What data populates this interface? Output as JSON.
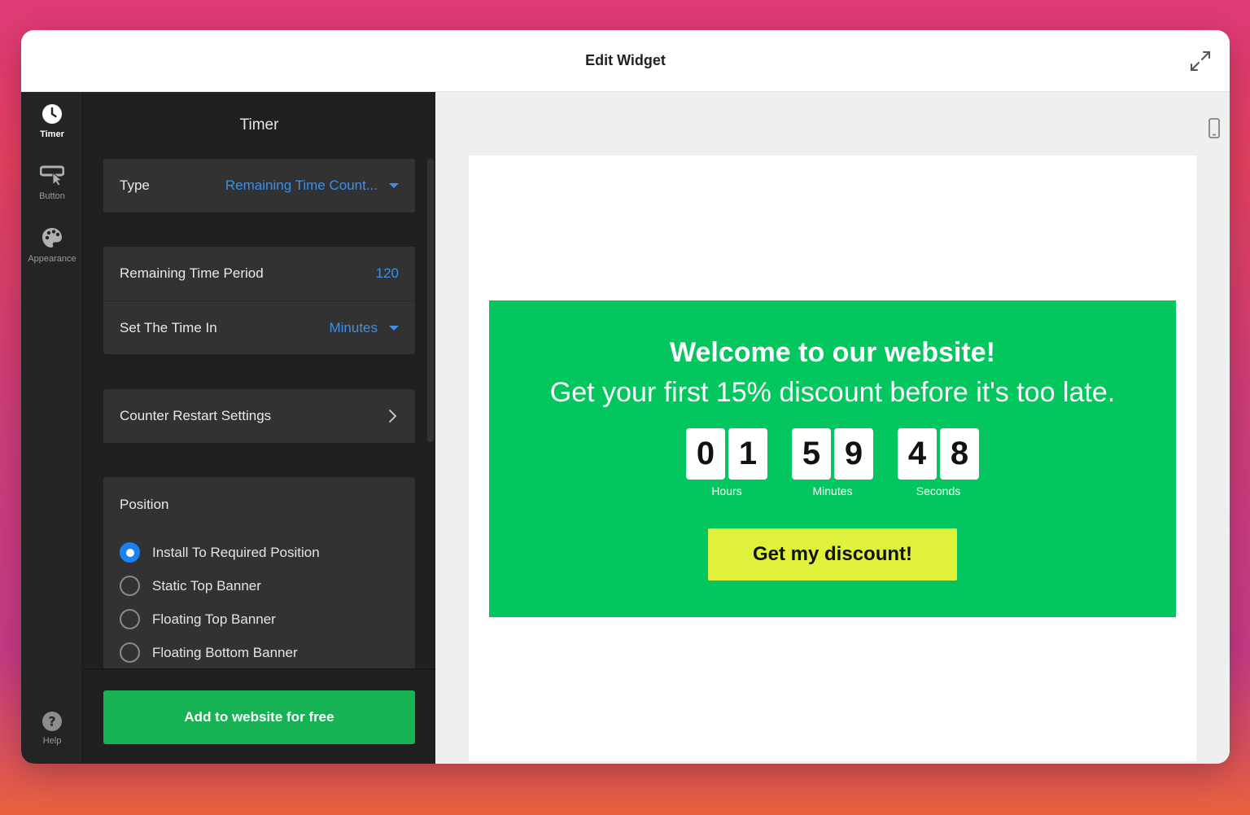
{
  "window": {
    "title": "Edit Widget"
  },
  "nav": {
    "items": [
      {
        "label": "Timer",
        "icon": "clock-icon",
        "active": true
      },
      {
        "label": "Button",
        "icon": "button-cursor-icon",
        "active": false
      },
      {
        "label": "Appearance",
        "icon": "palette-icon",
        "active": false
      }
    ],
    "help_label": "Help"
  },
  "panel": {
    "title": "Timer",
    "type": {
      "label": "Type",
      "value": "Remaining Time Count..."
    },
    "period": {
      "label": "Remaining Time Period",
      "value": "120"
    },
    "unit": {
      "label": "Set The Time In",
      "value": "Minutes"
    },
    "restart": {
      "label": "Counter Restart Settings"
    },
    "position": {
      "title": "Position",
      "options": [
        {
          "label": "Install To Required Position",
          "checked": true
        },
        {
          "label": "Static Top Banner",
          "checked": false
        },
        {
          "label": "Floating Top Banner",
          "checked": false
        },
        {
          "label": "Floating Bottom Banner",
          "checked": false
        }
      ]
    },
    "cta_label": "Add to website for free"
  },
  "preview": {
    "heading": "Welcome to our website!",
    "subheading": "Get your first 15% discount before it's too late.",
    "timer": [
      {
        "digits": [
          "0",
          "1"
        ],
        "label": "Hours"
      },
      {
        "digits": [
          "5",
          "9"
        ],
        "label": "Minutes"
      },
      {
        "digits": [
          "4",
          "8"
        ],
        "label": "Seconds"
      }
    ],
    "button_label": "Get my discount!",
    "colors": {
      "background": "#03c75e",
      "button": "#dff13a"
    }
  }
}
